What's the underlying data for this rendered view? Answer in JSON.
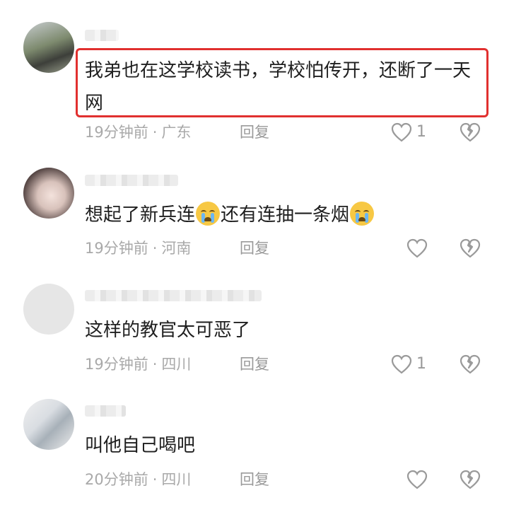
{
  "comments": [
    {
      "text": "我弟也在这学校读书，学校怕传开，还断了一天网",
      "time": "19分钟前",
      "location": "广东",
      "reply_label": "回复",
      "likes": "1"
    },
    {
      "text_parts": [
        "想起了新兵连",
        "还有连抽一条烟"
      ],
      "time": "19分钟前",
      "location": "河南",
      "reply_label": "回复",
      "likes": ""
    },
    {
      "text": "这样的教官太可恶了",
      "time": "19分钟前",
      "location": "四川",
      "reply_label": "回复",
      "likes": "1"
    },
    {
      "text": "叫他自己喝吧",
      "time": "20分钟前",
      "location": "四川",
      "reply_label": "回复",
      "likes": ""
    }
  ],
  "separator": "·",
  "icons": {
    "like": "heart-outline-icon",
    "dislike": "broken-heart-icon",
    "emoji": "crying-face-emoji"
  },
  "colors": {
    "highlight_border": "#e1302f",
    "meta_text": "#a9a9a9",
    "body_text": "#1f1f1f"
  }
}
